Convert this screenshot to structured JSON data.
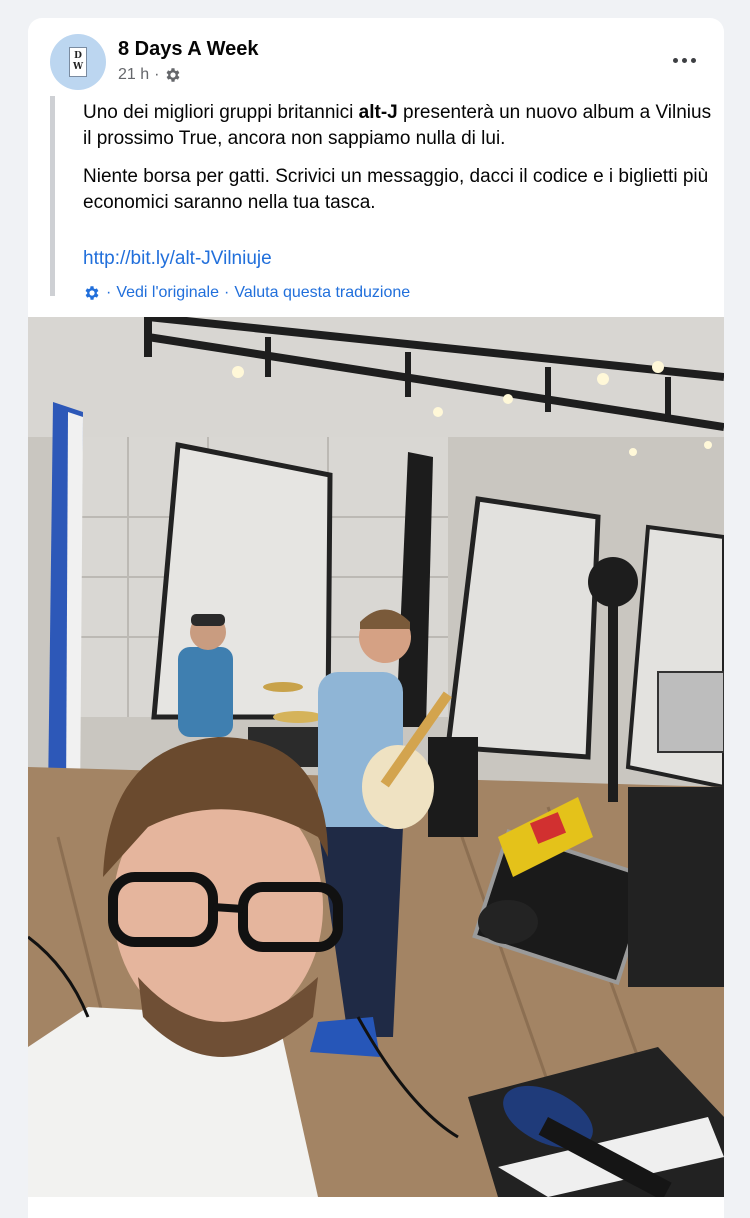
{
  "post": {
    "page_name": "8 Days A Week",
    "time": "21 h",
    "time_separator": "·",
    "avatar_letters": [
      "D",
      "W"
    ],
    "paragraph1": {
      "before": "Uno dei migliori gruppi britannici ",
      "bold": "alt-J",
      "after": " presenterà un nuovo album a Vilnius il prossimo True, ancora non sappiamo nulla di lui."
    },
    "paragraph2": "Niente borsa per gatti. Scrivici un messaggio, dacci il codice e i biglietti più economici saranno nella tua tasca.",
    "link": "http://bit.ly/alt-JVilniuje",
    "translation": {
      "separator": "·",
      "see_original": "Vedi l'originale",
      "rate": "Valuta questa traduzione"
    }
  },
  "icons": {
    "audience": "gear-icon",
    "more": "more-dots-icon",
    "translate": "gear-icon"
  },
  "colors": {
    "page_background": "#f0f2f5",
    "card": "#ffffff",
    "link": "#216fdb",
    "secondary_text": "#65676b",
    "quote_bar": "#ced0d4"
  }
}
